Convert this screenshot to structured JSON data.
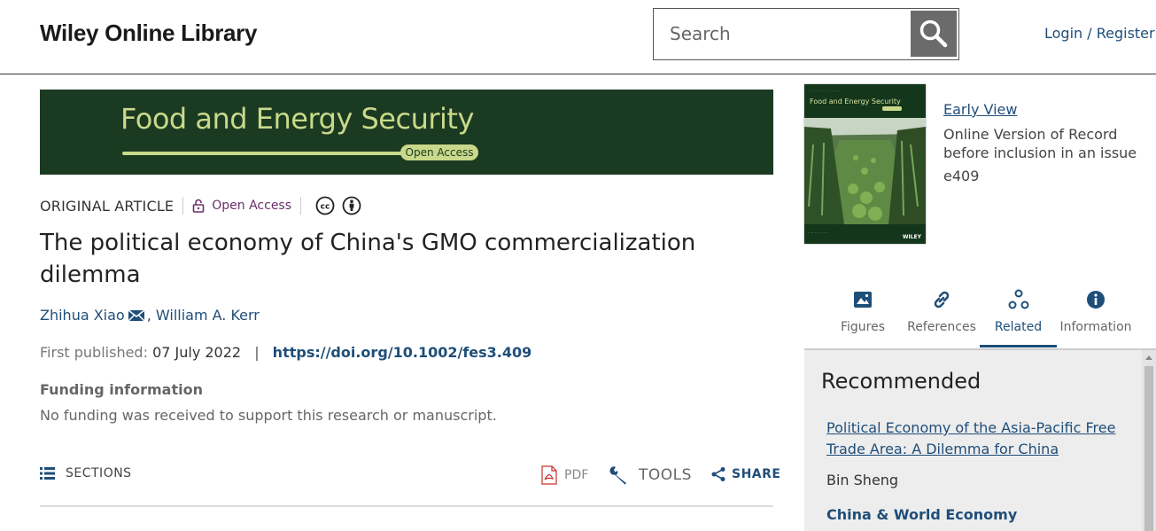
{
  "header": {
    "logo": "Wiley Online Library",
    "search_placeholder": "Search",
    "login_label": "Login / Register"
  },
  "banner": {
    "title": "Food and Energy Security",
    "badge": "Open Access"
  },
  "article": {
    "type": "ORIGINAL ARTICLE",
    "access_label": "Open Access",
    "title": "The political economy of China's GMO commercialization dilemma",
    "authors": [
      "Zhihua Xiao",
      "William A. Kerr"
    ],
    "author_separator": ",",
    "published_label": "First published:",
    "published_date": "07 July 2022",
    "pub_separator": "|",
    "doi": "https://doi.org/10.1002/fes3.409",
    "funding_heading": "Funding information",
    "funding_text": "No funding was received to support this research or manuscript."
  },
  "toolbar": {
    "sections_label": "SECTIONS",
    "pdf_label": "PDF",
    "tools_label": "TOOLS",
    "share_label": "SHARE"
  },
  "cover": {
    "journal_title": "Food and Energy Security",
    "publisher": "WILEY"
  },
  "early_view": {
    "label": "Early View",
    "description": "Online Version of Record before inclusion in an issue",
    "article_number": "e409"
  },
  "tabs": [
    {
      "label": "Figures",
      "icon": "image-icon"
    },
    {
      "label": "References",
      "icon": "link-icon"
    },
    {
      "label": "Related",
      "icon": "related-icon",
      "active": true
    },
    {
      "label": "Information",
      "icon": "info-icon"
    }
  ],
  "recommended": {
    "heading": "Recommended",
    "items": [
      {
        "title": "Political Economy of the Asia-Pacific Free Trade Area: A Dilemma for China",
        "author": "Bin Sheng",
        "journal": "China & World Economy"
      }
    ]
  },
  "colors": {
    "link": "#1f4e79",
    "banner_bg": "#1b3a22",
    "banner_text": "#c9d98a",
    "open_access": "#6b2f6b"
  }
}
